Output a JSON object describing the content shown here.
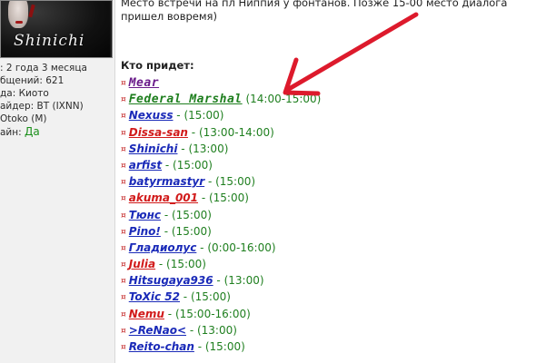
{
  "user": {
    "signature": "Shinichi",
    "rows": [
      {
        "text": ": 2 года 3 месяца"
      },
      {
        "text": "бщений: 621"
      },
      {
        "text": "да: Киото"
      },
      {
        "text": "айдер: BT (IXNN)"
      },
      {
        "text": "Otoko (M)"
      },
      {
        "text": "айн: ",
        "value": "Да"
      }
    ]
  },
  "post": {
    "line1": "Место встречи на пл Ниппия у фонтанов. Позже 15-00 место диалога",
    "line2": "пришел вовремя)",
    "heading": "Кто придет:"
  },
  "colors": {
    "red": "#d11a1a",
    "blue": "#1a2ab8",
    "purple": "#6a1c8a",
    "green": "#1f7f1f"
  },
  "people": [
    {
      "nick": "Mear",
      "color": "#6a1c8a",
      "time": "",
      "big": true
    },
    {
      "nick": "Federal Marshal",
      "color": "#1f7f1f",
      "time": "(14:00-15:00)",
      "big": true
    },
    {
      "nick": "Nexuss",
      "color": "#1a2ab8",
      "time": "(15:00)"
    },
    {
      "nick": "Dissa-san",
      "color": "#d11a1a",
      "time": "(13:00-14:00)"
    },
    {
      "nick": "Shinichi",
      "color": "#1a2ab8",
      "time": "(13:00)"
    },
    {
      "nick": "arfist",
      "color": "#1a2ab8",
      "time": "(15:00)"
    },
    {
      "nick": "batyrmastyr",
      "color": "#1a2ab8",
      "time": "(15:00)"
    },
    {
      "nick": "akuma_001",
      "color": "#d11a1a",
      "time": "(15:00)"
    },
    {
      "nick": "Тюнс",
      "color": "#1a2ab8",
      "time": "(15:00)"
    },
    {
      "nick": "Pino!",
      "color": "#1a2ab8",
      "time": "(15:00)"
    },
    {
      "nick": "Гладиолус",
      "color": "#1a2ab8",
      "time": "(0:00-16:00)"
    },
    {
      "nick": "Julia",
      "color": "#d11a1a",
      "time": "(15:00)"
    },
    {
      "nick": "Hitsugaya936",
      "color": "#1a2ab8",
      "time": "(13:00)"
    },
    {
      "nick": "ToXic 52",
      "color": "#1a2ab8",
      "time": "(15:00)"
    },
    {
      "nick": "Nemu",
      "color": "#d11a1a",
      "time": "(15:00-16:00)"
    },
    {
      "nick": ">ReNao<",
      "color": "#1a2ab8",
      "time": "(13:00)"
    },
    {
      "nick": "Reito-chan",
      "color": "#1a2ab8",
      "time": "(15:00)"
    }
  ]
}
